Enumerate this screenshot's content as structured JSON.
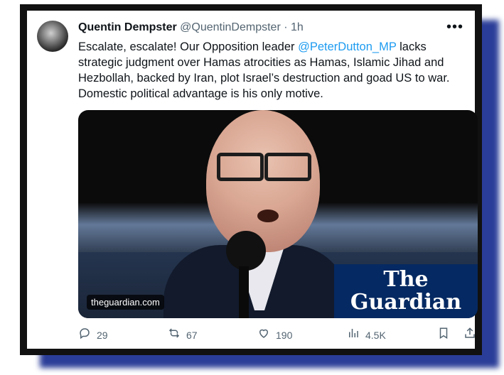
{
  "tweet": {
    "author_name": "Quentin Dempster",
    "handle_time": "@QuentinDempster · 1h",
    "more_icon": "more-icon",
    "text_before": "Escalate, escalate! Our Opposition leader ",
    "mention": "@PeterDutton_MP",
    "text_after": " lacks strategic judgment over Hamas atrocities as Hamas, Islamic Jihad and Hezbollah, backed by Iran, plot Israel’s destruction and goad US to war. Domestic political advantage is his only motive.",
    "media": {
      "source": "theguardian.com",
      "logo_line1": "The",
      "logo_line2": "Guardian"
    },
    "metrics": {
      "replies": "29",
      "reposts": "67",
      "likes": "190",
      "views": "4.5K"
    }
  }
}
